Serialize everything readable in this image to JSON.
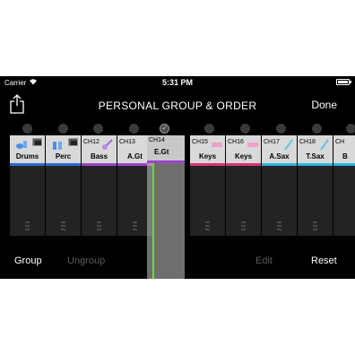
{
  "status": {
    "carrier": "Carrier",
    "time": "5:31 PM"
  },
  "nav": {
    "title": "PERSONAL GROUP & ORDER",
    "done": "Done",
    "share_icon": "share-icon"
  },
  "dots": {
    "checked_index": 4,
    "checkmark": "✓"
  },
  "channels": [
    {
      "ch": "",
      "name": "Drums",
      "color": "#2f6cd6",
      "icon": "drums-icon"
    },
    {
      "ch": "",
      "name": "Perc",
      "color": "#2f6cd6",
      "icon": "percussion-icon"
    },
    {
      "ch": "CH12",
      "name": "Bass",
      "color": "#9c44c8",
      "icon": "bass-guitar-icon"
    },
    {
      "ch": "CH13",
      "name": "A.Gt",
      "color": "#9c44c8",
      "icon": ""
    },
    {
      "ch": "",
      "name": "",
      "color": "#232323",
      "icon": ""
    },
    {
      "ch": "CH15",
      "name": "Keys",
      "color": "#d6357a",
      "icon": "keyboard-icon"
    },
    {
      "ch": "CH16",
      "name": "Keys",
      "color": "#d6357a",
      "icon": "keyboard-icon"
    },
    {
      "ch": "CH17",
      "name": "A.Sax",
      "color": "#2bb7e0",
      "icon": "saxophone-icon"
    },
    {
      "ch": "CH18",
      "name": "T.Sax",
      "color": "#2bb7e0",
      "icon": "saxophone-icon"
    },
    {
      "ch": "CH",
      "name": "B",
      "color": "#2bb7e0",
      "icon": ""
    }
  ],
  "dragging": {
    "ch": "CH14",
    "name": "E.Gt",
    "color": "#9c44c8",
    "guide_color": "#7bd435"
  },
  "bottom": {
    "group": "Group",
    "ungroup": "Ungroup",
    "edit": "Edit",
    "reset": "Reset"
  }
}
